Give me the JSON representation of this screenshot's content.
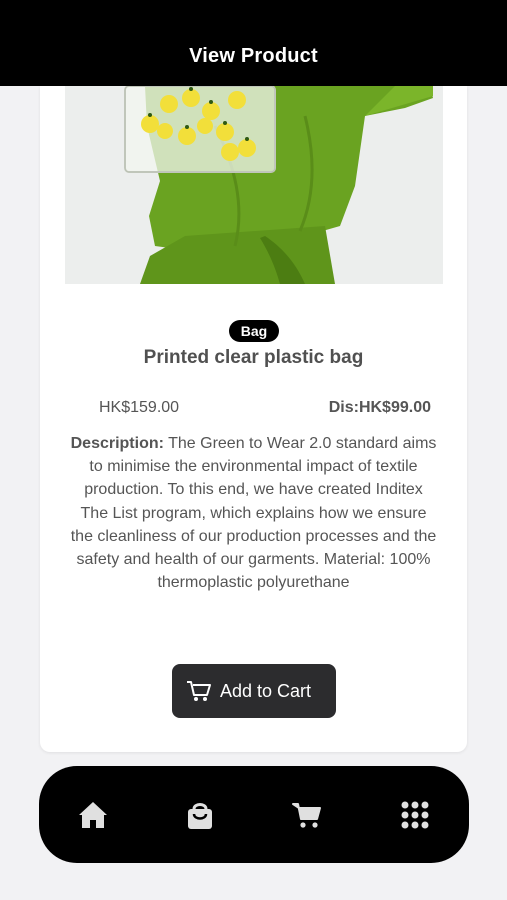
{
  "header": {
    "title": "View Product"
  },
  "product": {
    "category": "Bag",
    "name": "Printed clear plastic bag",
    "price": "HK$159.00",
    "discount_price": "Dis:HK$99.00",
    "description_label": "Description:",
    "description": " The Green to Wear 2.0 standard aims to minimise the environmental impact of textile production. To this end, we have created Inditex The List program, which explains how we ensure the cleanliness of our production processes and the safety and health of our garments. Material: 100% thermoplastic polyurethane"
  },
  "actions": {
    "add_to_cart": "Add to Cart"
  },
  "tabbar": {
    "items": [
      "home-icon",
      "shopping-bag-icon",
      "cart-icon",
      "grid-menu-icon"
    ]
  },
  "colors": {
    "accent": "#000000",
    "button": "#2c2c2e",
    "garment": "#6aa321"
  }
}
